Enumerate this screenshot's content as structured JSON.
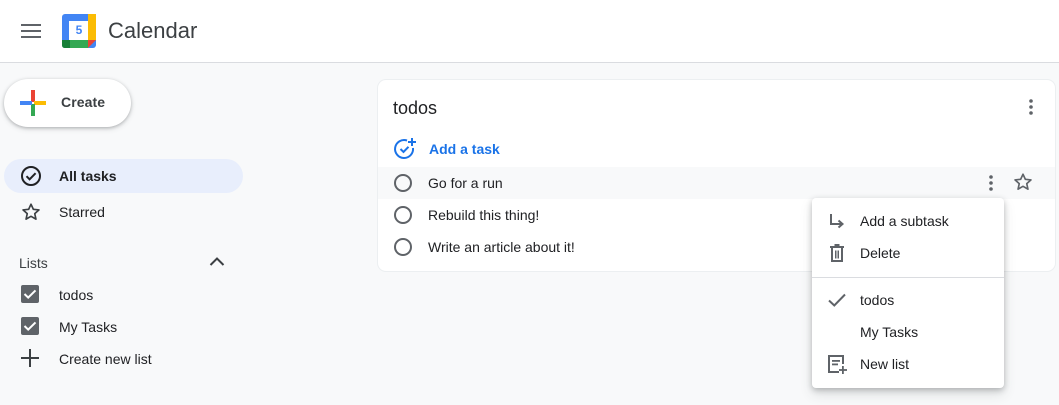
{
  "header": {
    "app_title": "Calendar",
    "logo_day": "5"
  },
  "sidebar": {
    "create_label": "Create",
    "nav": [
      {
        "label": "All tasks",
        "icon": "check-circle-icon",
        "active": true
      },
      {
        "label": "Starred",
        "icon": "star-icon",
        "active": false
      }
    ],
    "lists_heading": "Lists",
    "lists": [
      {
        "label": "todos",
        "checked": true
      },
      {
        "label": "My Tasks",
        "checked": true
      }
    ],
    "create_list_label": "Create new list"
  },
  "main": {
    "list_title": "todos",
    "add_task_label": "Add a task",
    "tasks": [
      {
        "title": "Go for a run"
      },
      {
        "title": "Rebuild this thing!"
      },
      {
        "title": "Write an article about it!"
      }
    ]
  },
  "context_menu": {
    "items": [
      {
        "label": "Add a subtask",
        "icon": "subtask-arrow-icon"
      },
      {
        "label": "Delete",
        "icon": "trash-icon"
      }
    ],
    "move_to": [
      {
        "label": "todos",
        "selected": true
      },
      {
        "label": "My Tasks",
        "selected": false
      }
    ],
    "new_list_label": "New list"
  },
  "colors": {
    "accent": "#1a73e8",
    "active_nav_bg": "#e8eefc",
    "text_primary": "#202124",
    "icon_gray": "#5f6368"
  }
}
